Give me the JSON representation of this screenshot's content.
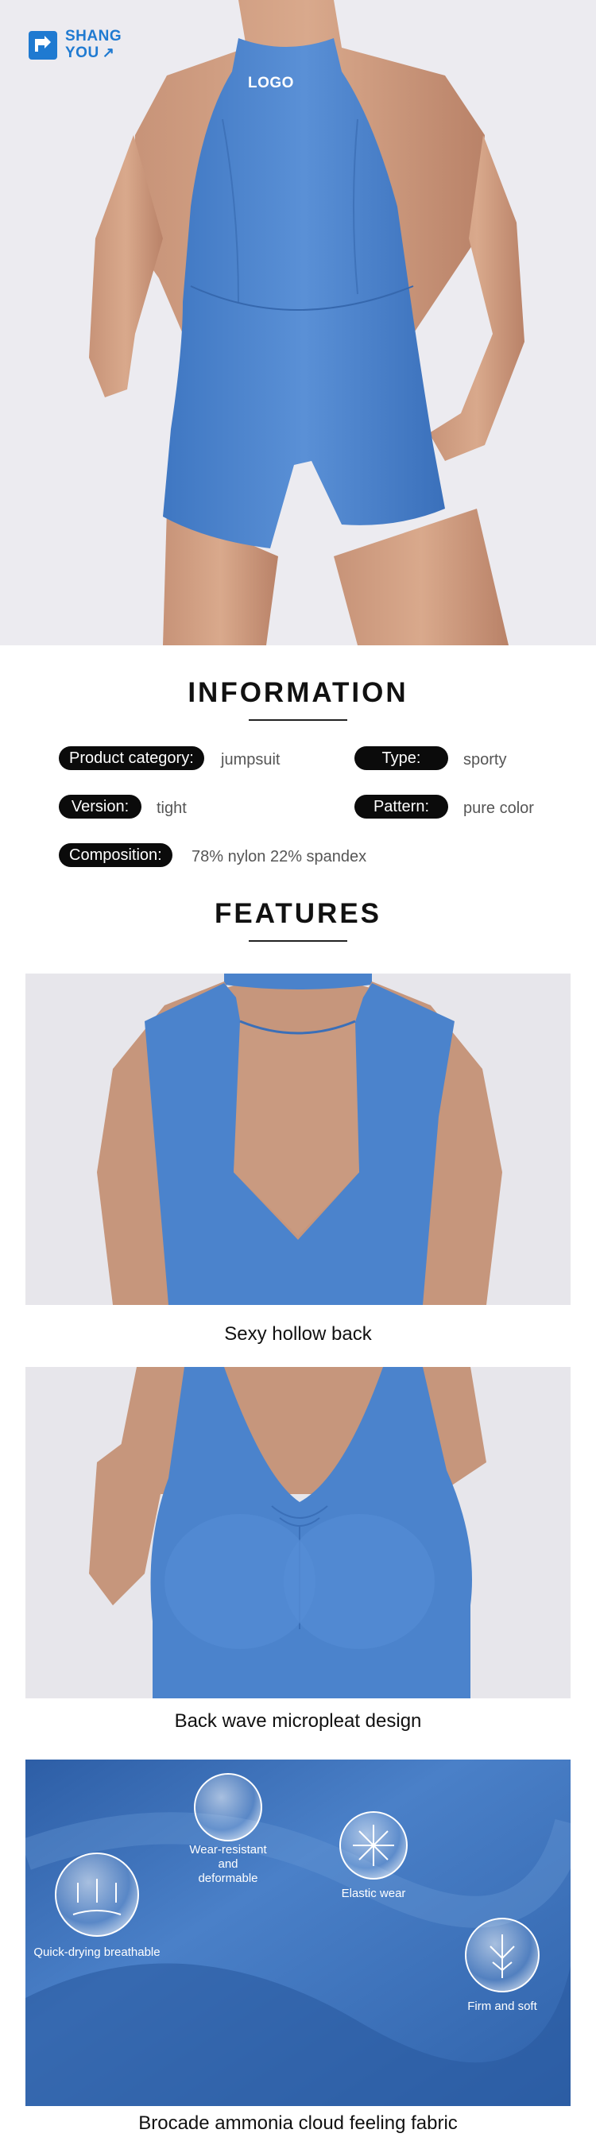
{
  "brand": {
    "line1": "SHANG",
    "line2": "YOU",
    "arrow": "↗",
    "color": "#1f7ad1"
  },
  "hero": {
    "logo_text": "LOGO",
    "garment_color": "#4b83cc"
  },
  "information": {
    "title": "INFORMATION",
    "rows": [
      {
        "label": "Product category:",
        "value": "jumpsuit"
      },
      {
        "label": "Type:",
        "value": "sporty"
      },
      {
        "label": "Version:",
        "value": "tight"
      },
      {
        "label": "Pattern:",
        "value": "pure color"
      },
      {
        "label": "Composition:",
        "value": "78% nylon 22% spandex"
      }
    ]
  },
  "features": {
    "title": "FEATURES",
    "items": [
      {
        "caption": "Sexy hollow back"
      },
      {
        "caption": "Back wave micropleat design"
      },
      {
        "caption": "Brocade ammonia cloud feeling fabric"
      }
    ],
    "fabric_labels": {
      "wear": [
        "Wear-resistant",
        "and",
        "deformable"
      ],
      "elastic": "Elastic wear",
      "quick": "Quick-drying breathable",
      "firm": "Firm and soft"
    }
  }
}
